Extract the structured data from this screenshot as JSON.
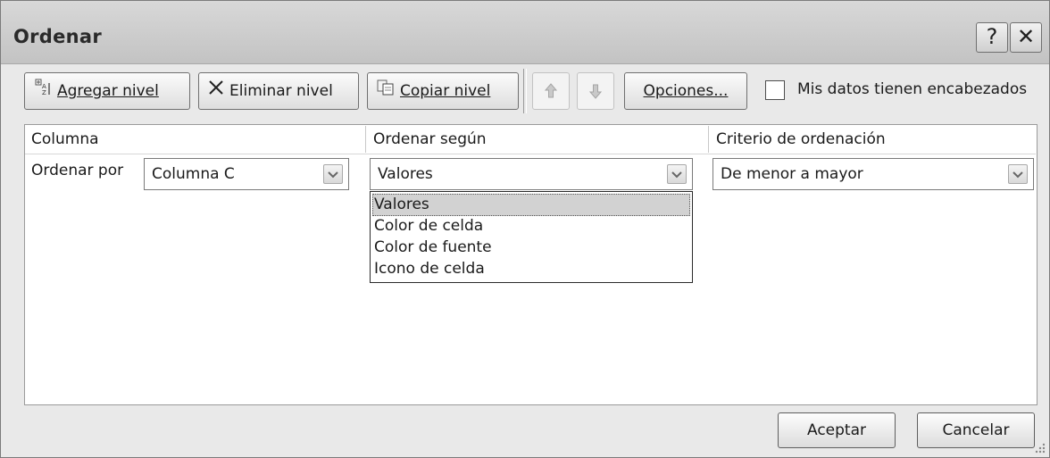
{
  "window": {
    "title": "Ordenar"
  },
  "titlebar_buttons": {
    "help": "?",
    "close": "✕"
  },
  "toolbar": {
    "add_level_label": "Agregar nivel",
    "delete_level_label": "Eliminar nivel",
    "copy_level_label": "Copiar nivel",
    "options_label": "Opciones...",
    "headers_checkbox_label": "Mis datos tienen encabezados",
    "headers_checked": false
  },
  "grid": {
    "headers": {
      "column": "Columna",
      "sort_on": "Ordenar según",
      "order": "Criterio de ordenación"
    },
    "row": {
      "label": "Ordenar por",
      "column_value": "Columna C",
      "sort_on_value": "Valores",
      "order_value": "De menor a mayor"
    }
  },
  "dropdown": {
    "options": [
      "Valores",
      "Color de celda",
      "Color de fuente",
      "Icono de celda"
    ],
    "selected": "Valores"
  },
  "footer": {
    "ok_label": "Aceptar",
    "cancel_label": "Cancelar"
  }
}
